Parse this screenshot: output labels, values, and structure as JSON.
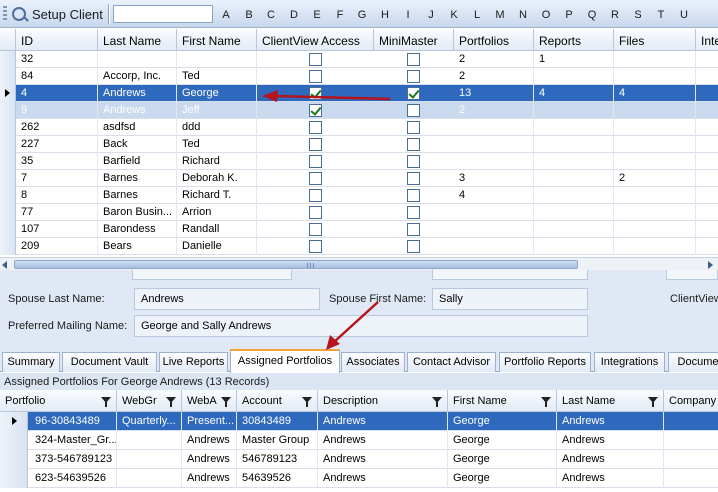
{
  "toolbar": {
    "title": "Setup Client",
    "letters": [
      "A",
      "B",
      "C",
      "D",
      "E",
      "F",
      "G",
      "H",
      "I",
      "J",
      "K",
      "L",
      "M",
      "N",
      "O",
      "P",
      "Q",
      "R",
      "S",
      "T",
      "U"
    ]
  },
  "grid": {
    "columns": [
      "ID",
      "Last Name",
      "First Name",
      "ClientView Access",
      "MiniMaster",
      "Portfolios",
      "Reports",
      "Files",
      "Inte"
    ],
    "rows": [
      {
        "id": "32",
        "last": "",
        "first": "",
        "cv": false,
        "mm": false,
        "portfolios": "2",
        "reports": "1",
        "files": ""
      },
      {
        "id": "84",
        "last": "Accorp, Inc.",
        "first": "Ted",
        "cv": false,
        "mm": false,
        "portfolios": "2",
        "reports": "",
        "files": ""
      },
      {
        "id": "4",
        "last": "Andrews",
        "first": "George",
        "cv": true,
        "mm": true,
        "portfolios": "13",
        "reports": "4",
        "files": "4"
      },
      {
        "id": "9",
        "last": "Andrews",
        "first": "Jeff",
        "cv": true,
        "mm": false,
        "portfolios": "2",
        "reports": "",
        "files": ""
      },
      {
        "id": "262",
        "last": "asdfsd",
        "first": "ddd",
        "cv": false,
        "mm": false,
        "portfolios": "",
        "reports": "",
        "files": ""
      },
      {
        "id": "227",
        "last": "Back",
        "first": "Ted",
        "cv": false,
        "mm": false,
        "portfolios": "",
        "reports": "",
        "files": ""
      },
      {
        "id": "35",
        "last": "Barfield",
        "first": "Richard",
        "cv": false,
        "mm": false,
        "portfolios": "",
        "reports": "",
        "files": ""
      },
      {
        "id": "7",
        "last": "Barnes",
        "first": "Deborah K.",
        "cv": false,
        "mm": false,
        "portfolios": "3",
        "reports": "",
        "files": "2"
      },
      {
        "id": "8",
        "last": "Barnes",
        "first": "Richard T.",
        "cv": false,
        "mm": false,
        "portfolios": "4",
        "reports": "",
        "files": ""
      },
      {
        "id": "77",
        "last": "Baron Busin...",
        "first": "Arrion",
        "cv": false,
        "mm": false,
        "portfolios": "",
        "reports": "",
        "files": ""
      },
      {
        "id": "107",
        "last": "Barondess",
        "first": "Randall",
        "cv": false,
        "mm": false,
        "portfolios": "",
        "reports": "",
        "files": ""
      },
      {
        "id": "209",
        "last": "Bears",
        "first": "Danielle",
        "cv": false,
        "mm": false,
        "portfolios": "",
        "reports": "",
        "files": ""
      }
    ]
  },
  "details": {
    "spouse_last_label": "Spouse Last Name:",
    "spouse_last_value": "Andrews",
    "spouse_first_label": "Spouse First Name:",
    "spouse_first_value": "Sally",
    "clientview_label": "ClientView",
    "mailing_label": "Preferred Mailing Name:",
    "mailing_value": "George and Sally Andrews"
  },
  "tabs": [
    "Summary",
    "Document Vault",
    "Live Reports",
    "Assigned Portfolios",
    "Associates",
    "Contact Advisor",
    "Portfolio Reports",
    "Integrations",
    "Docume"
  ],
  "active_tab": "Assigned Portfolios",
  "caption": "Assigned Portfolios For George Andrews (13 Records)",
  "grid2": {
    "columns": [
      "Portfolio",
      "WebGr",
      "WebA",
      "Account",
      "Description",
      "First Name",
      "Last Name",
      "Company"
    ],
    "rows": [
      {
        "portfolio": "96-30843489",
        "webgr": "Quarterly...",
        "weba": "Present...",
        "account": "30843489",
        "description": "Andrews",
        "first": "George",
        "last": "Andrews"
      },
      {
        "portfolio": "324-Master_Gr...",
        "webgr": "",
        "weba": "Andrews",
        "account": "Master Group",
        "description": "Andrews",
        "first": "George",
        "last": "Andrews"
      },
      {
        "portfolio": "373-546789123",
        "webgr": "",
        "weba": "Andrews",
        "account": "546789123",
        "description": "Andrews",
        "first": "George",
        "last": "Andrews"
      },
      {
        "portfolio": "623-54639526",
        "webgr": "",
        "weba": "Andrews",
        "account": "54639526",
        "description": "Andrews",
        "first": "George",
        "last": "Andrews"
      }
    ]
  },
  "colors": {
    "selection": "#2f69be",
    "annotation_arrow": "#b5141c",
    "active_tab_accent": "#f0a33a"
  }
}
